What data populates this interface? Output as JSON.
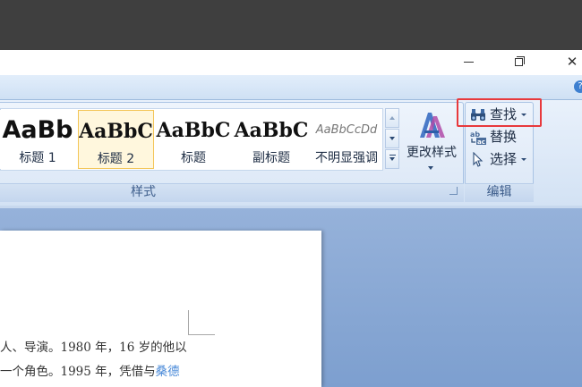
{
  "window": {
    "close_glyph": "✕"
  },
  "help": {
    "glyph": "?"
  },
  "styles_group": {
    "label": "样式",
    "gallery": [
      {
        "preview": "AaBb",
        "label": "标题 1",
        "selected": false
      },
      {
        "preview": "AaBbC",
        "label": "标题 2",
        "selected": true
      },
      {
        "preview": "AaBbC",
        "label": "标题",
        "selected": false
      },
      {
        "preview": "AaBbC",
        "label": "副标题",
        "selected": false
      },
      {
        "preview": "AaBbCcDd",
        "label": "不明显强调",
        "selected": false
      }
    ],
    "change_styles_label": "更改样式"
  },
  "editing_group": {
    "label": "编辑",
    "find_label": "查找",
    "replace_label": "替换",
    "select_label": "选择"
  },
  "document": {
    "line1": "人、导演。1980 年，16 岁的他以",
    "line2_text": "一个角色。1995 年，凭借与",
    "line2_link": "桑德"
  },
  "colors": {
    "highlight": "#e8393c",
    "link": "#4a8ad8",
    "selected_tile_border": "#f3c557"
  },
  "icons": [
    "binoculars-icon",
    "replace-icon",
    "cursor-select-icon",
    "change-styles-icon",
    "dialog-launcher-icon",
    "help-icon"
  ]
}
